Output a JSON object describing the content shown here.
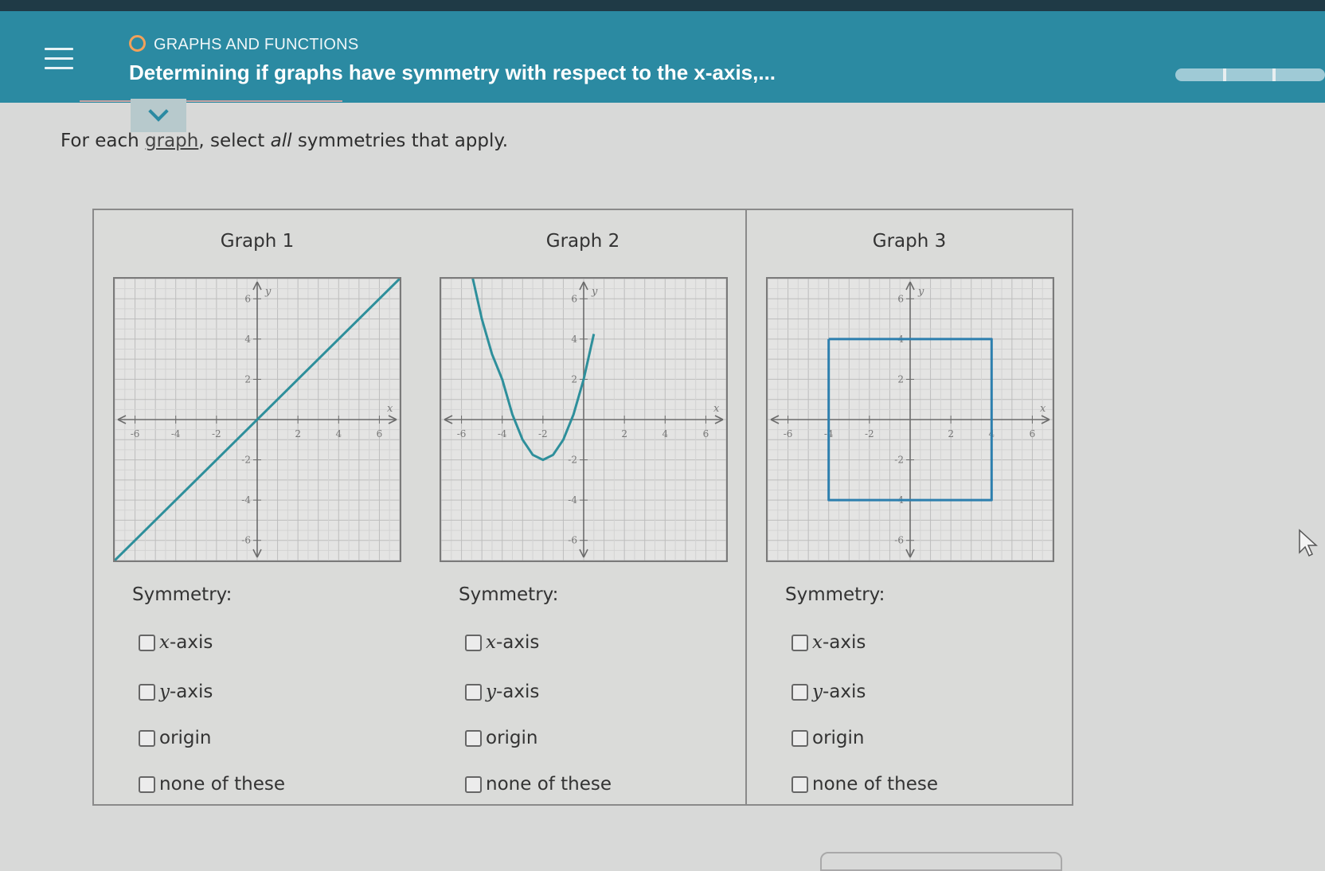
{
  "header": {
    "category": "GRAPHS AND FUNCTIONS",
    "title": "Determining if graphs have symmetry with respect to the x-axis,..."
  },
  "instruction": {
    "prefix": "For each ",
    "link": "graph",
    "middle": ", select ",
    "emphasis": "all",
    "suffix": " symmetries that apply."
  },
  "panels": [
    {
      "title": "Graph 1",
      "symmetry_label": "Symmetry:",
      "options": [
        {
          "var": "x",
          "label": "-axis",
          "checked": false
        },
        {
          "var": "y",
          "label": "-axis",
          "checked": false
        },
        {
          "var": "",
          "label": "origin",
          "checked": false
        },
        {
          "var": "",
          "label": "none of these",
          "checked": false
        }
      ]
    },
    {
      "title": "Graph 2",
      "symmetry_label": "Symmetry:",
      "options": [
        {
          "var": "x",
          "label": "-axis",
          "checked": false
        },
        {
          "var": "y",
          "label": "-axis",
          "checked": false
        },
        {
          "var": "",
          "label": "origin",
          "checked": false
        },
        {
          "var": "",
          "label": "none of these",
          "checked": false
        }
      ]
    },
    {
      "title": "Graph 3",
      "symmetry_label": "Symmetry:",
      "options": [
        {
          "var": "x",
          "label": "-axis",
          "checked": false
        },
        {
          "var": "y",
          "label": "-axis",
          "checked": false
        },
        {
          "var": "",
          "label": "origin",
          "checked": false
        },
        {
          "var": "",
          "label": "none of these",
          "checked": false
        }
      ]
    }
  ],
  "graph_axes": {
    "x_label": "x",
    "y_label": "y",
    "x_ticks": [
      "-6",
      "-4",
      "-2",
      "2",
      "4",
      "6"
    ],
    "y_ticks": [
      "6",
      "4",
      "2",
      "-2",
      "-4",
      "-6"
    ],
    "range": [
      -7,
      7
    ]
  },
  "chart_data": [
    {
      "type": "line",
      "graph": "Graph 1",
      "x": [
        -7,
        7
      ],
      "y": [
        -7,
        7
      ]
    },
    {
      "type": "line",
      "graph": "Graph 2",
      "x": [
        -5.5,
        -5,
        -4.5,
        -4,
        -3.5,
        -3,
        -2.5,
        -2,
        -1.5,
        -1,
        -0.5,
        0,
        0.5
      ],
      "y": [
        7.25,
        5,
        3.25,
        2,
        0.25,
        -1,
        -1.75,
        -2,
        -1.75,
        -1,
        0.25,
        2,
        4.25
      ]
    },
    {
      "type": "line",
      "graph": "Graph 3",
      "x": [
        -4,
        4,
        4,
        -4,
        -4
      ],
      "y": [
        4,
        4,
        -4,
        -4,
        4
      ]
    }
  ],
  "colors": {
    "header_bg": "#2b8aa2",
    "curve": "#2e8f9b",
    "square": "#2d7fae",
    "accent_ring": "#f2a15a"
  }
}
